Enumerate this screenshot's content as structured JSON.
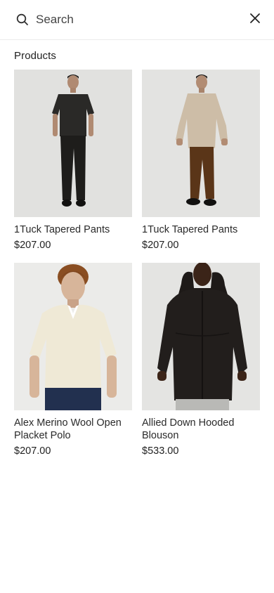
{
  "search": {
    "placeholder": "Search",
    "value": ""
  },
  "icons": {
    "search": "search-icon",
    "close": "close-icon"
  },
  "section": {
    "title": "Products"
  },
  "products": [
    {
      "name": "1Tuck Tapered Pants",
      "price": "$207.00"
    },
    {
      "name": "1Tuck Tapered Pants",
      "price": "$207.00"
    },
    {
      "name": "Alex Merino Wool Open Placket Polo",
      "price": "$207.00"
    },
    {
      "name": "Allied Down Hooded Blouson",
      "price": "$533.00"
    }
  ]
}
